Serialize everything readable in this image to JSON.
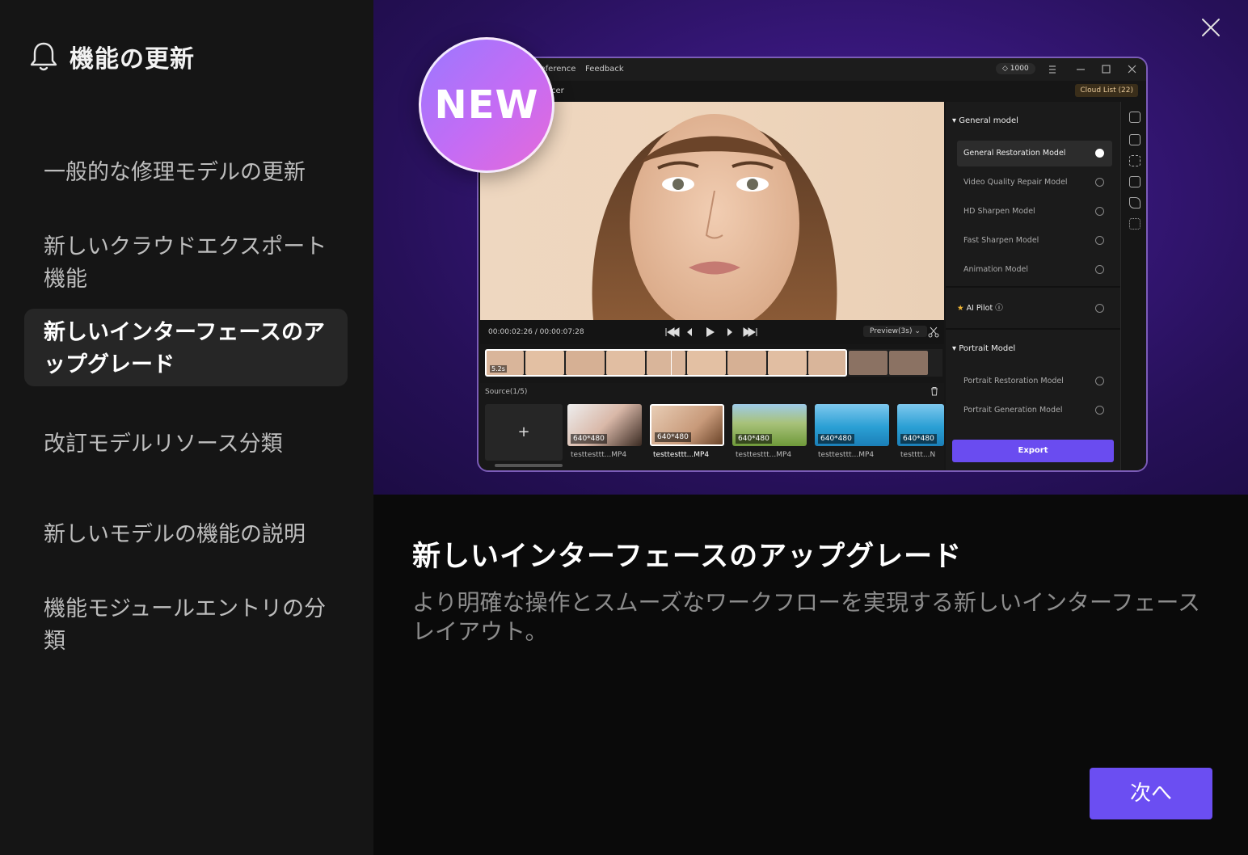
{
  "sidebar": {
    "title": "機能の更新",
    "items": [
      {
        "label": "一般的な修理モデルの更新"
      },
      {
        "label": "新しいクラウドエクスポート機能"
      },
      {
        "label": "新しいインターフェースのアップグレード"
      },
      {
        "label": "改訂モデルリソース分類"
      },
      {
        "label": "新しいモデルの機能の説明"
      },
      {
        "label": "機能モジュールエントリの分類"
      }
    ],
    "active_index": 2
  },
  "badge": {
    "label": "NEW"
  },
  "screenshot": {
    "menu": {
      "reference": "Reference",
      "feedback": "Feedback"
    },
    "credits": "1000",
    "cloud_list": "Cloud List (22)",
    "window_title": "cer",
    "time": "00:00:02:26 / 00:00:07:28",
    "preview_select": "Preview(3s)",
    "strip_label": "5.2s",
    "source_title": "Source(1/5)",
    "add_symbol": "+",
    "thumbs": [
      {
        "res": "640*480",
        "name": "testtesttt...MP4"
      },
      {
        "res": "640*480",
        "name": "testtesttt...MP4"
      },
      {
        "res": "640*480",
        "name": "testtesttt...MP4"
      },
      {
        "res": "640*480",
        "name": "testtesttt...MP4"
      },
      {
        "res": "640*480",
        "name": "testttt...N"
      }
    ],
    "panel": {
      "general_header": "General model",
      "general_options": [
        "General Restoration Model",
        "Video Quality Repair Model",
        "HD Sharpen Model",
        "Fast Sharpen Model",
        "Animation Model"
      ],
      "ai_pilot": "AI Pilot ⓘ",
      "portrait_header": "Portrait Model",
      "portrait_options": [
        "Portrait Restoration Model",
        "Portrait Generation Model"
      ],
      "export_label": "Export"
    }
  },
  "main": {
    "headline": "新しいインターフェースのアップグレード",
    "description": "より明確な操作とスムーズなワークフローを実現する新しいインターフェースレイアウト。",
    "next_label": "次へ"
  },
  "colors": {
    "accent": "#6b4ef2",
    "sidebar_bg": "#151515",
    "hero_bg": "#37177a"
  }
}
